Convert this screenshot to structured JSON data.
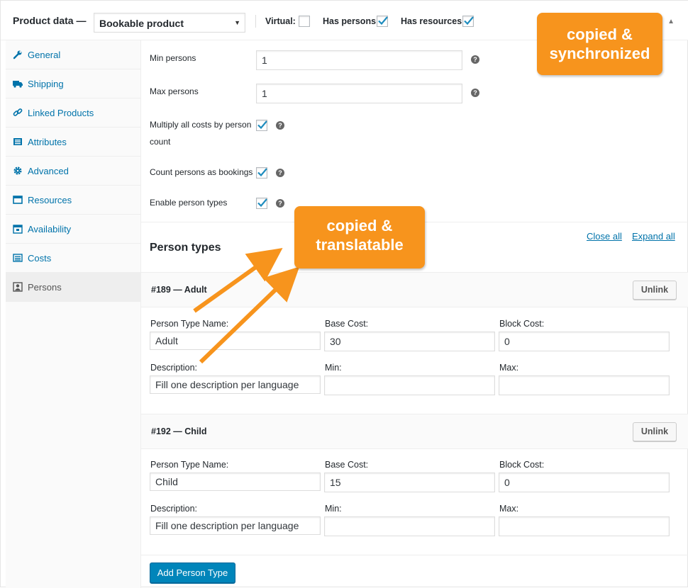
{
  "header": {
    "title": "Product data —",
    "product_type": "Bookable product",
    "virtual_label": "Virtual:",
    "has_persons_label": "Has persons:",
    "has_resources_label": "Has resources:"
  },
  "sidebar": {
    "items": [
      {
        "label": "General",
        "icon": "wrench-icon"
      },
      {
        "label": "Shipping",
        "icon": "truck-icon"
      },
      {
        "label": "Linked Products",
        "icon": "link-icon"
      },
      {
        "label": "Attributes",
        "icon": "list-icon"
      },
      {
        "label": "Advanced",
        "icon": "gear-icon"
      },
      {
        "label": "Resources",
        "icon": "window-icon"
      },
      {
        "label": "Availability",
        "icon": "calendar-icon"
      },
      {
        "label": "Costs",
        "icon": "list-icon"
      },
      {
        "label": "Persons",
        "icon": "person-icon"
      }
    ]
  },
  "persons": {
    "min_label": "Min persons",
    "min_value": "1",
    "max_label": "Max persons",
    "max_value": "1",
    "multiply_label_1": "Multiply all costs by person",
    "multiply_label_2": "count",
    "count_label": "Count persons as bookings",
    "enable_label": "Enable person types",
    "help_glyph": "?"
  },
  "person_types": {
    "title": "Person types",
    "close_all": "Close all",
    "expand_all": "Expand all",
    "items": [
      {
        "heading": "#189 — Adult",
        "unlink": "Unlink",
        "name_label": "Person Type Name:",
        "name_value": "Adult",
        "base_cost_label": "Base Cost:",
        "base_cost_value": "30",
        "block_cost_label": "Block Cost:",
        "block_cost_value": "0",
        "description_label": "Description:",
        "description_value": "Fill one description per language",
        "min_label": "Min:",
        "max_label": "Max:"
      },
      {
        "heading": "#192 — Child",
        "unlink": "Unlink",
        "name_label": "Person Type Name:",
        "name_value": "Child",
        "base_cost_label": "Base Cost:",
        "base_cost_value": "15",
        "block_cost_label": "Block Cost:",
        "block_cost_value": "0",
        "description_label": "Description:",
        "description_value": "Fill one description per language",
        "min_label": "Min:",
        "max_label": "Max:"
      }
    ],
    "add_button": "Add Person Type"
  },
  "annotations": {
    "callout_sync_1": "copied &",
    "callout_sync_2": "synchronized",
    "callout_trans_1": "copied &",
    "callout_trans_2": "translatable",
    "color": "#f7941d"
  }
}
